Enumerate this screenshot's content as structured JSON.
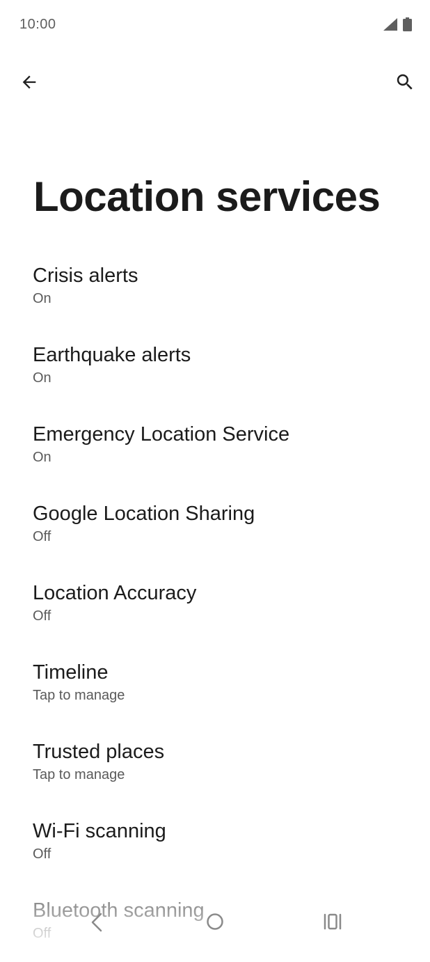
{
  "status_bar": {
    "time": "10:00",
    "icons": [
      "signal-icon",
      "battery-icon"
    ]
  },
  "app_bar": {
    "back_icon": "arrow-back-icon",
    "search_icon": "search-icon"
  },
  "page": {
    "title": "Location services"
  },
  "items": [
    {
      "title": "Crisis alerts",
      "summary": "On"
    },
    {
      "title": "Earthquake alerts",
      "summary": "On"
    },
    {
      "title": "Emergency Location Service",
      "summary": "On"
    },
    {
      "title": "Google Location Sharing",
      "summary": "Off"
    },
    {
      "title": "Location Accuracy",
      "summary": "Off"
    },
    {
      "title": "Timeline",
      "summary": "Tap to manage"
    },
    {
      "title": "Trusted places",
      "summary": "Tap to manage"
    },
    {
      "title": "Wi-Fi scanning",
      "summary": "Off"
    },
    {
      "title": "Bluetooth scanning",
      "summary": "Off"
    }
  ],
  "nav_bar": {
    "icons": [
      "nav-back-icon",
      "nav-home-icon",
      "nav-recents-icon"
    ]
  },
  "colors": {
    "title": "#1b1b1b",
    "summary": "#5a5a5a",
    "status": "#5f5f5f",
    "background": "#ffffff"
  }
}
